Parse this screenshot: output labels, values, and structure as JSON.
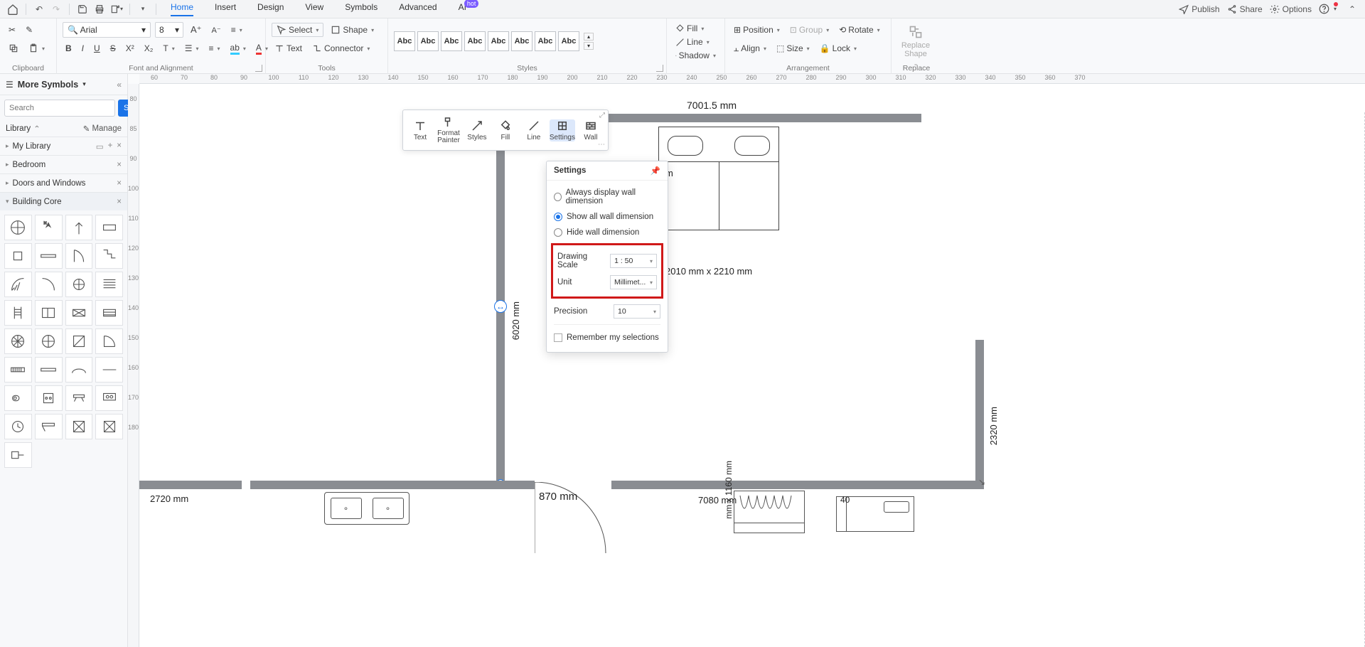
{
  "topbar": {
    "publish": "Publish",
    "share": "Share",
    "options": "Options"
  },
  "tabs": [
    "Home",
    "Insert",
    "Design",
    "View",
    "Symbols",
    "Advanced",
    "AI"
  ],
  "tabs_active": 0,
  "ai_badge": "hot",
  "font": {
    "name": "Arial",
    "size": "8"
  },
  "ribbon": {
    "clipboard": "Clipboard",
    "font_align": "Font and Alignment",
    "tools": "Tools",
    "styles": "Styles",
    "arrangement": "Arrangement",
    "replace": "Replace",
    "select": "Select",
    "shape": "Shape",
    "text": "Text",
    "connector": "Connector",
    "fill": "Fill",
    "line": "Line",
    "shadow": "Shadow",
    "position": "Position",
    "group": "Group",
    "rotate": "Rotate",
    "align": "Align",
    "size": "Size",
    "lock": "Lock",
    "replace_shape": "Replace\nShape",
    "abc": "Abc"
  },
  "side": {
    "title": "More Symbols",
    "search_ph": "Search",
    "search_btn": "Search",
    "library": "Library",
    "manage": "Manage",
    "cats": [
      "My Library",
      "Bedroom",
      "Doors and Windows",
      "Building Core"
    ]
  },
  "ruler_h": [
    "60",
    "70",
    "80",
    "90",
    "100",
    "110",
    "120",
    "130",
    "140",
    "150",
    "160",
    "170",
    "180",
    "190",
    "200",
    "210",
    "220",
    "230",
    "240",
    "250",
    "260",
    "270",
    "280",
    "290",
    "300",
    "310",
    "320",
    "330",
    "340",
    "350",
    "360",
    "370"
  ],
  "ruler_v": [
    "80",
    "85",
    "90",
    "100",
    "110",
    "120",
    "130",
    "140",
    "150",
    "160",
    "170",
    "180"
  ],
  "float": {
    "items": [
      "Text",
      "Format Painter",
      "Styles",
      "Fill",
      "Line",
      "Settings",
      "Wall"
    ],
    "selected": 5
  },
  "settings": {
    "title": "Settings",
    "radios": [
      "Always display wall dimension",
      "Show all wall dimension",
      "Hide wall dimension"
    ],
    "radio_sel": 1,
    "scale_lbl": "Drawing Scale",
    "scale_val": "1 : 50",
    "unit_lbl": "Unit",
    "unit_val": "Millimet...",
    "precision_lbl": "Precision",
    "precision_val": "10",
    "remember": "Remember my selections"
  },
  "dims": {
    "top": "7001.5 mm",
    "left": "6020 mm",
    "door1": "870 mm",
    "bottom": "7080 mm",
    "bedsize": "2010 mm  x  2210 mm",
    "strip_v": "mm x 1160 mm",
    "seg": "2720 mm",
    "right": "2320 mm",
    "r40": "40"
  }
}
